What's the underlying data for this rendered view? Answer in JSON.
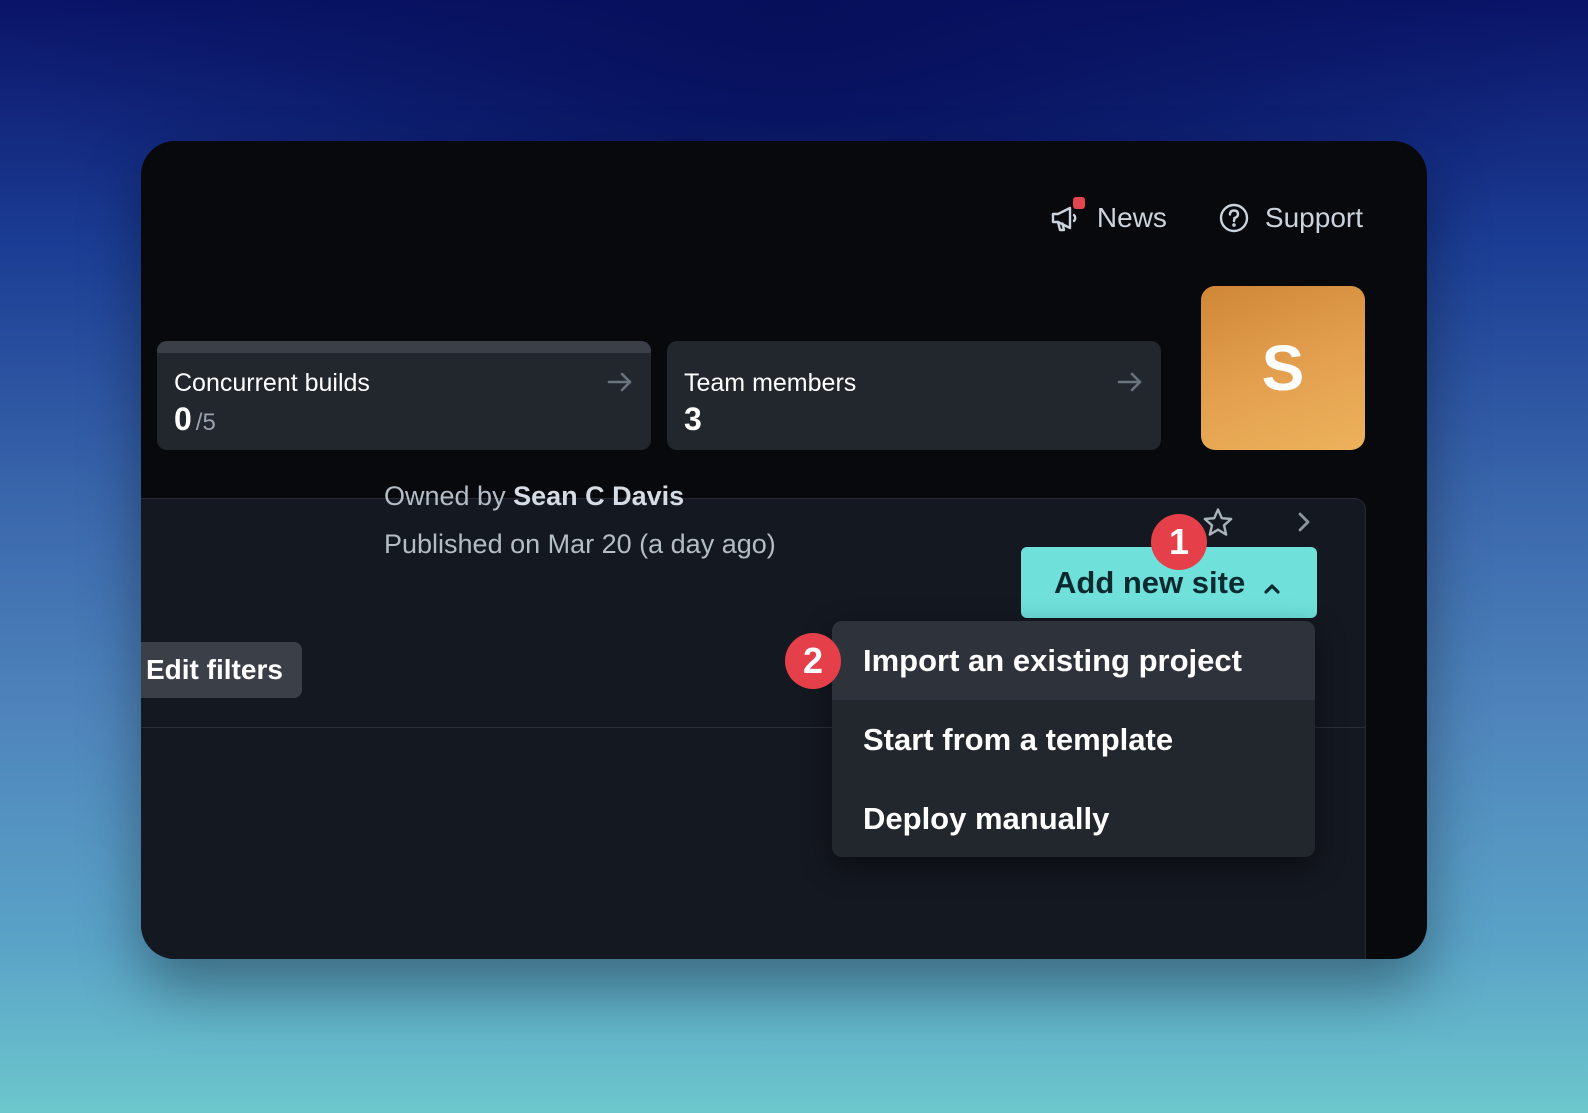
{
  "header": {
    "news_label": "News",
    "support_label": "Support",
    "news_icon": "megaphone-icon",
    "support_icon": "question-circle-icon"
  },
  "stats": {
    "builds": {
      "label": "Concurrent builds",
      "value": "0",
      "total": "/5"
    },
    "team": {
      "label": "Team members",
      "value": "3"
    }
  },
  "avatar": {
    "initial": "S",
    "color": "#e4a150"
  },
  "toolbar": {
    "edit_filters_label": "Edit filters",
    "add_site_label": "Add new site"
  },
  "dropdown": {
    "items": [
      {
        "label": "Import an existing project"
      },
      {
        "label": "Start from a template"
      },
      {
        "label": "Deploy manually"
      }
    ]
  },
  "annotations": {
    "step1": "1",
    "step2": "2"
  },
  "site": {
    "owner_prefix": "Owned by",
    "owner_name": "Sean C Davis",
    "published": "Published on Mar 20 (a day ago)"
  },
  "colors": {
    "accent": "#6fe0da",
    "badge": "#e5404a",
    "notification": "#e5454f"
  }
}
